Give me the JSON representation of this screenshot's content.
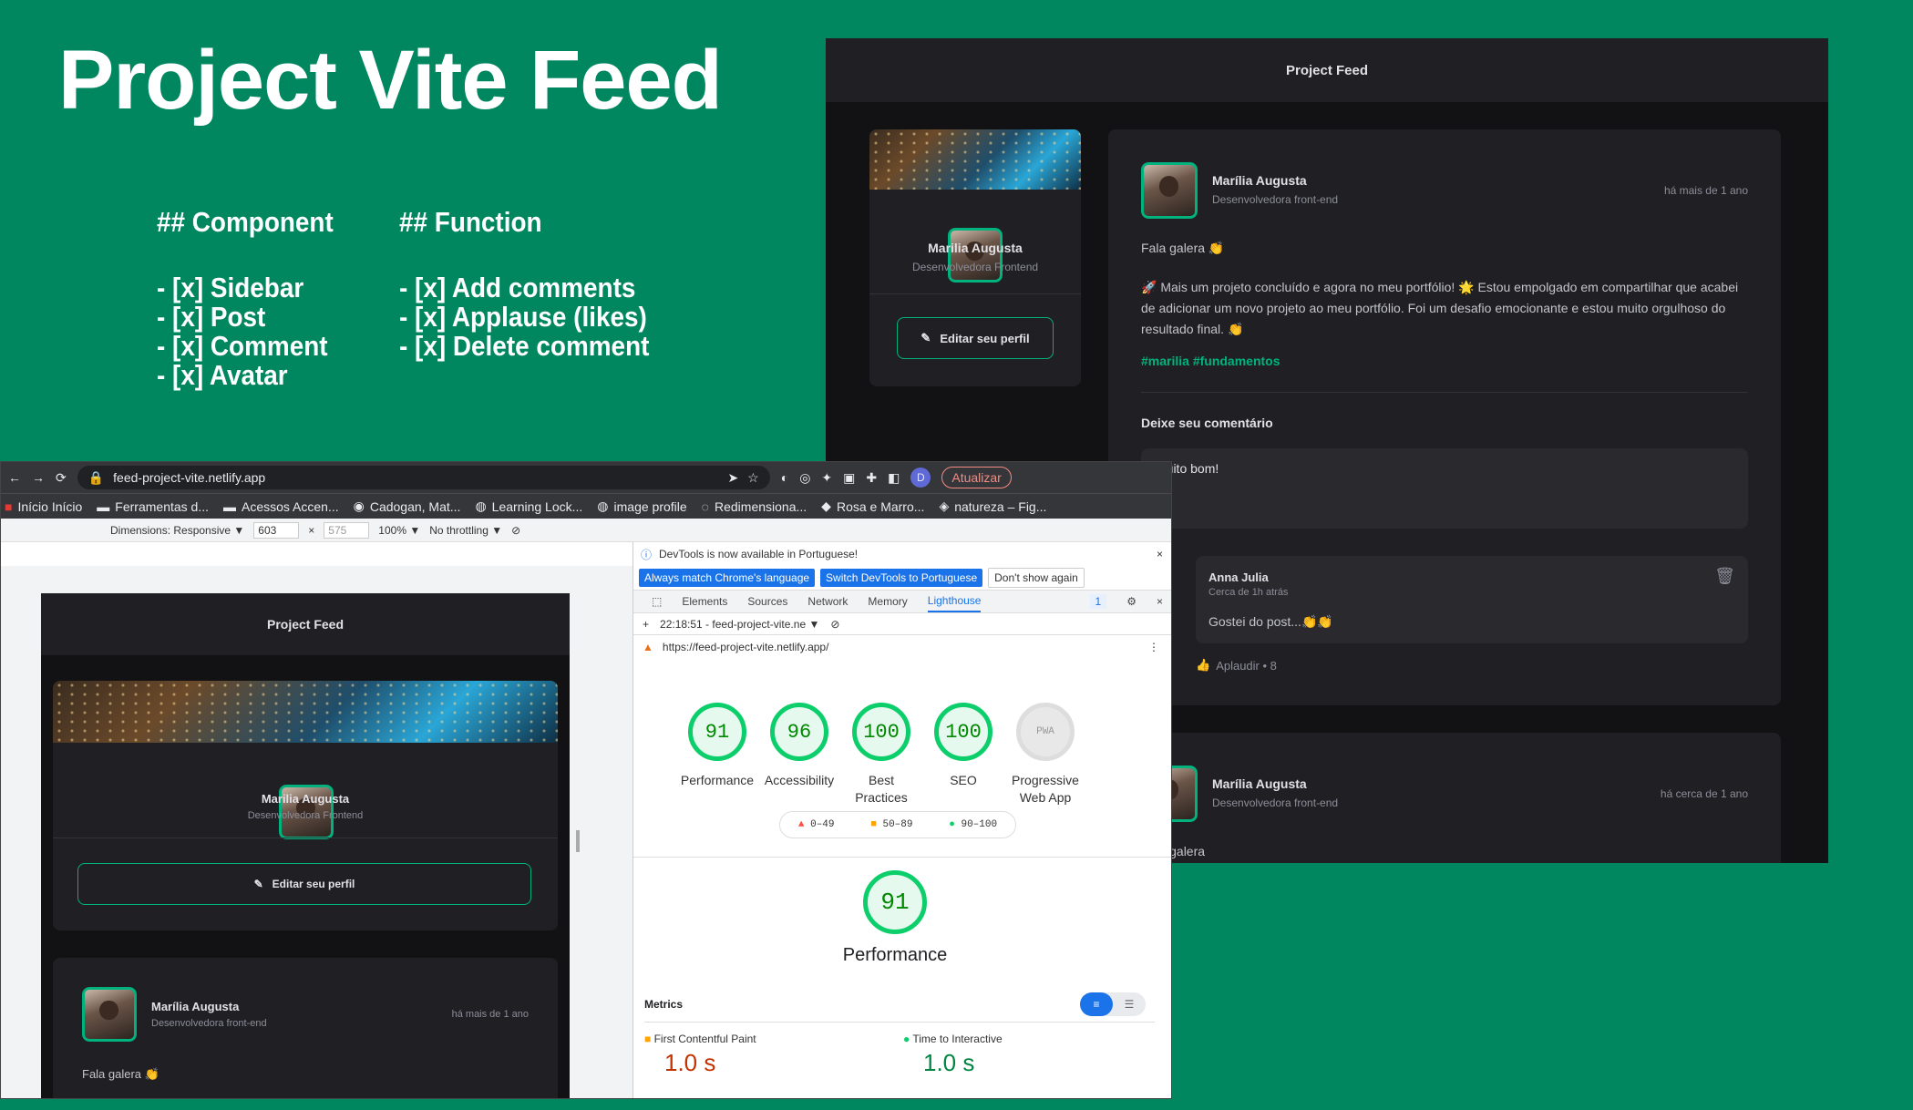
{
  "title": "Project Vite Feed",
  "component_heading": "## Component",
  "function_heading": "## Function",
  "components": [
    "- [x]  Sidebar",
    "- [x]  Post",
    "- [x]  Comment",
    "- [x]  Avatar"
  ],
  "functions": [
    "- [x] Add comments",
    "- [x] Applause (likes)",
    "- [x] Delete comment"
  ],
  "feed": {
    "header_title": "Project Feed",
    "sidebar": {
      "name": "Marilia Augusta",
      "role": "Desenvolvedora Frontend",
      "edit_button": "Editar seu perfil"
    },
    "post1": {
      "author": "Marília Augusta",
      "role": "Desenvolvedora front-end",
      "time": "há mais de 1 ano",
      "greeting": "Fala galera 👏",
      "body": "🚀 Mais um projeto concluído e agora no meu portfólio! 🌟 Estou empolgado em compartilhar que acabei de adicionar um novo projeto ao meu portfólio. Foi um desafio emocionante e estou muito orgulhoso do resultado final. 👏",
      "hashtags": "#marilia #fundamentos",
      "comment_heading": "Deixe seu comentário",
      "comment_value": "Muito bom!",
      "comment": {
        "author": "Anna Julia",
        "time": "Cerca de 1h atrás",
        "text": "Gostei do post...👏👏",
        "applause": "Aplaudir • 8"
      }
    },
    "post2": {
      "author": "Marília Augusta",
      "role": "Desenvolvedora front-end",
      "time": "há cerca de 1 ano",
      "greeting": "Fala galera"
    }
  },
  "browser": {
    "url": "feed-project-vite.netlify.app",
    "update_button": "Atualizar",
    "profile_letter": "D",
    "bookmarks": [
      "Início Início",
      "Ferramentas d...",
      "Acessos Accen...",
      "Cadogan, Mat...",
      "Learning Lock...",
      "image profile",
      "Redimensiona...",
      "Rosa e Marro...",
      "natureza – Fig..."
    ],
    "device_label": "Dimensions: Responsive ▼",
    "width": "603",
    "height": "575",
    "zoom": "100% ▼",
    "throttle": "No throttling ▼",
    "mobile": {
      "header_title": "Project Feed",
      "name": "Marilia Augusta",
      "role": "Desenvolvedora Frontend",
      "edit_button": "Editar seu perfil",
      "post_author": "Marília Augusta",
      "post_role": "Desenvolvedora front-end",
      "post_time": "há mais de 1 ano",
      "post_greeting": "Fala galera 👏"
    }
  },
  "devtools": {
    "banner": "DevTools is now available in Portuguese!",
    "btn_match": "Always match Chrome's language",
    "btn_switch": "Switch DevTools to Portuguese",
    "btn_dont": "Don't show again",
    "tabs": [
      "Elements",
      "Sources",
      "Network",
      "Memory",
      "Lighthouse"
    ],
    "active_tab": "Lighthouse",
    "badge": "1",
    "report_time": "22:18:51 - feed-project-vite.ne ▼",
    "report_url": "https://feed-project-vite.netlify.app/",
    "scores": [
      {
        "value": "91",
        "label": "Performance"
      },
      {
        "value": "96",
        "label": "Accessibility"
      },
      {
        "value": "100",
        "label": "Best Practices"
      },
      {
        "value": "100",
        "label": "SEO"
      },
      {
        "value": "PWA",
        "label": "Progressive Web App"
      }
    ],
    "legend": [
      "0–49",
      "50–89",
      "90–100"
    ],
    "big_score": "91",
    "big_label": "Performance",
    "metrics_heading": "Metrics",
    "metric1": {
      "label": "First Contentful Paint",
      "value": "1.0 s"
    },
    "metric2": {
      "label": "Time to Interactive",
      "value": "1.0 s"
    }
  },
  "colors": {
    "background": "#00875f",
    "accent": "#00b37e",
    "dark": "#121214",
    "card": "#202024"
  }
}
